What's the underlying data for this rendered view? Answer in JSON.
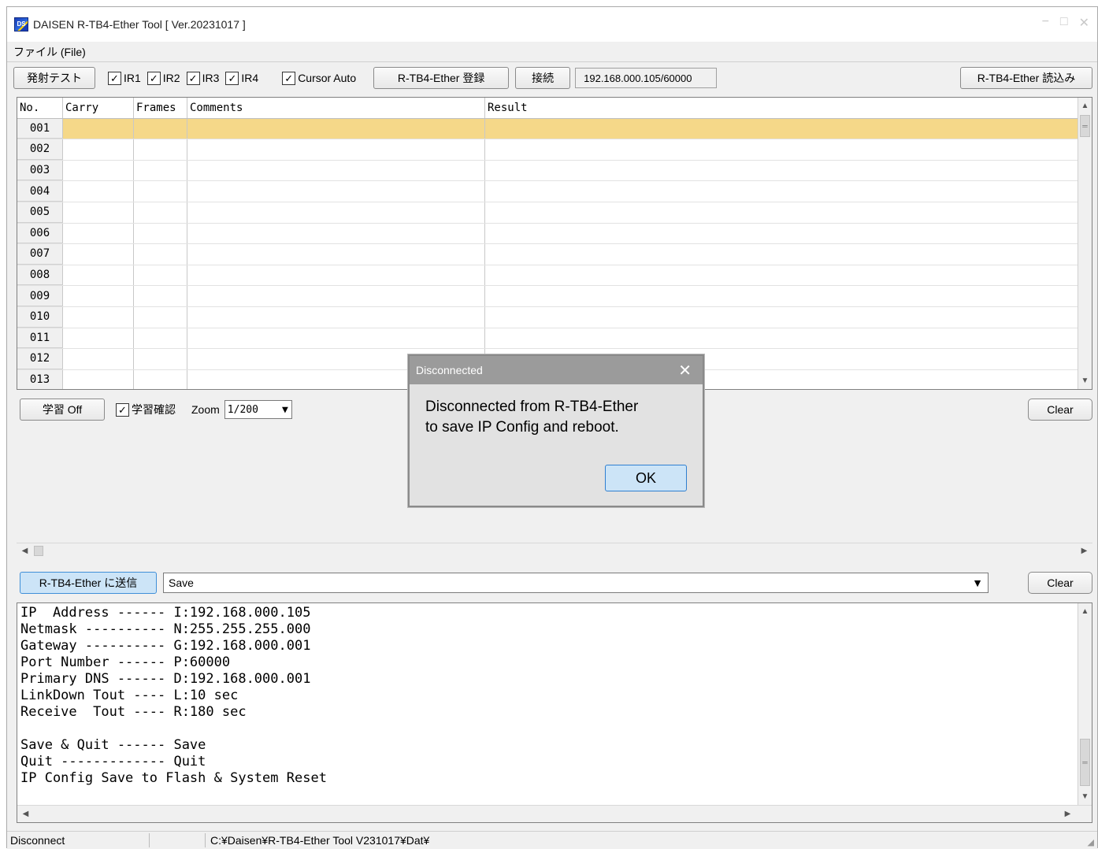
{
  "window": {
    "title": "DAISEN R-TB4-Ether Tool  [ Ver.20231017 ]",
    "icon_text": "DS",
    "controls": {
      "minimize": "−",
      "maximize": "□",
      "close": "✕"
    }
  },
  "menu": {
    "file": "ファイル (File)"
  },
  "toolbar": {
    "fire_test": "発射テスト",
    "checks": [
      {
        "label": "IR1",
        "checked": true
      },
      {
        "label": "IR2",
        "checked": true
      },
      {
        "label": "IR3",
        "checked": true
      },
      {
        "label": "IR4",
        "checked": true
      },
      {
        "label": "Cursor Auto",
        "checked": true
      }
    ],
    "register": "R-TB4-Ether 登録",
    "connect": "接続",
    "address": "192.168.000.105/60000",
    "load": "R-TB4-Ether 読込み"
  },
  "grid": {
    "headers": {
      "no": "No.",
      "carry": "Carry",
      "frames": "Frames",
      "comments": "Comments",
      "result": "Result"
    },
    "rows": [
      "001",
      "002",
      "003",
      "004",
      "005",
      "006",
      "007",
      "008",
      "009",
      "010",
      "011",
      "012",
      "013"
    ],
    "selected_row": "001"
  },
  "learn_bar": {
    "learn_off": "学習 Off",
    "learn_confirm": "学習確認",
    "learn_confirm_checked": true,
    "zoom_label": "Zoom",
    "zoom_value": "1/200",
    "clear": "Clear"
  },
  "send_bar": {
    "send_button": "R-TB4-Ether に送信",
    "command_value": "Save",
    "clear": "Clear"
  },
  "console": {
    "lines": [
      "IP  Address ------ I:192.168.000.105",
      "Netmask ---------- N:255.255.255.000",
      "Gateway ---------- G:192.168.000.001",
      "Port Number ------ P:60000",
      "Primary DNS ------ D:192.168.000.001",
      "LinkDown Tout ---- L:10 sec",
      "Receive  Tout ---- R:180 sec",
      "",
      "Save & Quit ------ Save",
      "Quit ------------- Quit",
      "IP Config Save to Flash & System Reset"
    ]
  },
  "status": {
    "connection": "Disconnect",
    "path": "C:¥Daisen¥R-TB4-Ether Tool V231017¥Dat¥"
  },
  "dialog": {
    "title": "Disconnected",
    "message_line1": "Disconnected from R-TB4-Ether",
    "message_line2": "to save IP Config and reboot.",
    "ok": "OK",
    "close": "✕"
  },
  "colors": {
    "selected_row": "#f5d889",
    "dialog_title": "#9b9b9b",
    "primary_button": "#cce4f7"
  }
}
